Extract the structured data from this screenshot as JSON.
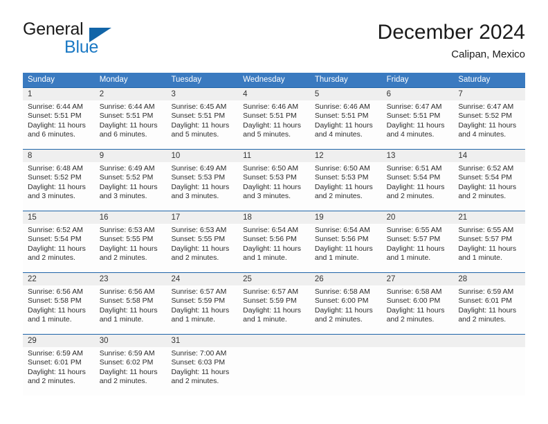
{
  "logo": {
    "word1": "General",
    "word2": "Blue",
    "triangle_color": "#1265a8",
    "blue_text_color": "#1b79c4"
  },
  "header": {
    "title": "December 2024",
    "subtitle": "Calipan, Mexico"
  },
  "theme": {
    "header_blue": "#3a7ac0",
    "separator_blue": "#1d63a8",
    "numrow_gray": "#efefef",
    "text_dark": "#2b2b2b"
  },
  "labels": {
    "sunrise_prefix": "Sunrise:",
    "sunset_prefix": "Sunset:",
    "daylight_prefix": "Daylight:"
  },
  "weekdays": [
    "Sunday",
    "Monday",
    "Tuesday",
    "Wednesday",
    "Thursday",
    "Friday",
    "Saturday"
  ],
  "weeks": [
    {
      "days": [
        {
          "num": "1",
          "sunrise": "Sunrise: 6:44 AM",
          "sunset": "Sunset: 5:51 PM",
          "daylight1": "Daylight: 11 hours",
          "daylight2": "and 6 minutes."
        },
        {
          "num": "2",
          "sunrise": "Sunrise: 6:44 AM",
          "sunset": "Sunset: 5:51 PM",
          "daylight1": "Daylight: 11 hours",
          "daylight2": "and 6 minutes."
        },
        {
          "num": "3",
          "sunrise": "Sunrise: 6:45 AM",
          "sunset": "Sunset: 5:51 PM",
          "daylight1": "Daylight: 11 hours",
          "daylight2": "and 5 minutes."
        },
        {
          "num": "4",
          "sunrise": "Sunrise: 6:46 AM",
          "sunset": "Sunset: 5:51 PM",
          "daylight1": "Daylight: 11 hours",
          "daylight2": "and 5 minutes."
        },
        {
          "num": "5",
          "sunrise": "Sunrise: 6:46 AM",
          "sunset": "Sunset: 5:51 PM",
          "daylight1": "Daylight: 11 hours",
          "daylight2": "and 4 minutes."
        },
        {
          "num": "6",
          "sunrise": "Sunrise: 6:47 AM",
          "sunset": "Sunset: 5:51 PM",
          "daylight1": "Daylight: 11 hours",
          "daylight2": "and 4 minutes."
        },
        {
          "num": "7",
          "sunrise": "Sunrise: 6:47 AM",
          "sunset": "Sunset: 5:52 PM",
          "daylight1": "Daylight: 11 hours",
          "daylight2": "and 4 minutes."
        }
      ]
    },
    {
      "days": [
        {
          "num": "8",
          "sunrise": "Sunrise: 6:48 AM",
          "sunset": "Sunset: 5:52 PM",
          "daylight1": "Daylight: 11 hours",
          "daylight2": "and 3 minutes."
        },
        {
          "num": "9",
          "sunrise": "Sunrise: 6:49 AM",
          "sunset": "Sunset: 5:52 PM",
          "daylight1": "Daylight: 11 hours",
          "daylight2": "and 3 minutes."
        },
        {
          "num": "10",
          "sunrise": "Sunrise: 6:49 AM",
          "sunset": "Sunset: 5:53 PM",
          "daylight1": "Daylight: 11 hours",
          "daylight2": "and 3 minutes."
        },
        {
          "num": "11",
          "sunrise": "Sunrise: 6:50 AM",
          "sunset": "Sunset: 5:53 PM",
          "daylight1": "Daylight: 11 hours",
          "daylight2": "and 3 minutes."
        },
        {
          "num": "12",
          "sunrise": "Sunrise: 6:50 AM",
          "sunset": "Sunset: 5:53 PM",
          "daylight1": "Daylight: 11 hours",
          "daylight2": "and 2 minutes."
        },
        {
          "num": "13",
          "sunrise": "Sunrise: 6:51 AM",
          "sunset": "Sunset: 5:54 PM",
          "daylight1": "Daylight: 11 hours",
          "daylight2": "and 2 minutes."
        },
        {
          "num": "14",
          "sunrise": "Sunrise: 6:52 AM",
          "sunset": "Sunset: 5:54 PM",
          "daylight1": "Daylight: 11 hours",
          "daylight2": "and 2 minutes."
        }
      ]
    },
    {
      "days": [
        {
          "num": "15",
          "sunrise": "Sunrise: 6:52 AM",
          "sunset": "Sunset: 5:54 PM",
          "daylight1": "Daylight: 11 hours",
          "daylight2": "and 2 minutes."
        },
        {
          "num": "16",
          "sunrise": "Sunrise: 6:53 AM",
          "sunset": "Sunset: 5:55 PM",
          "daylight1": "Daylight: 11 hours",
          "daylight2": "and 2 minutes."
        },
        {
          "num": "17",
          "sunrise": "Sunrise: 6:53 AM",
          "sunset": "Sunset: 5:55 PM",
          "daylight1": "Daylight: 11 hours",
          "daylight2": "and 2 minutes."
        },
        {
          "num": "18",
          "sunrise": "Sunrise: 6:54 AM",
          "sunset": "Sunset: 5:56 PM",
          "daylight1": "Daylight: 11 hours",
          "daylight2": "and 1 minute."
        },
        {
          "num": "19",
          "sunrise": "Sunrise: 6:54 AM",
          "sunset": "Sunset: 5:56 PM",
          "daylight1": "Daylight: 11 hours",
          "daylight2": "and 1 minute."
        },
        {
          "num": "20",
          "sunrise": "Sunrise: 6:55 AM",
          "sunset": "Sunset: 5:57 PM",
          "daylight1": "Daylight: 11 hours",
          "daylight2": "and 1 minute."
        },
        {
          "num": "21",
          "sunrise": "Sunrise: 6:55 AM",
          "sunset": "Sunset: 5:57 PM",
          "daylight1": "Daylight: 11 hours",
          "daylight2": "and 1 minute."
        }
      ]
    },
    {
      "days": [
        {
          "num": "22",
          "sunrise": "Sunrise: 6:56 AM",
          "sunset": "Sunset: 5:58 PM",
          "daylight1": "Daylight: 11 hours",
          "daylight2": "and 1 minute."
        },
        {
          "num": "23",
          "sunrise": "Sunrise: 6:56 AM",
          "sunset": "Sunset: 5:58 PM",
          "daylight1": "Daylight: 11 hours",
          "daylight2": "and 1 minute."
        },
        {
          "num": "24",
          "sunrise": "Sunrise: 6:57 AM",
          "sunset": "Sunset: 5:59 PM",
          "daylight1": "Daylight: 11 hours",
          "daylight2": "and 1 minute."
        },
        {
          "num": "25",
          "sunrise": "Sunrise: 6:57 AM",
          "sunset": "Sunset: 5:59 PM",
          "daylight1": "Daylight: 11 hours",
          "daylight2": "and 1 minute."
        },
        {
          "num": "26",
          "sunrise": "Sunrise: 6:58 AM",
          "sunset": "Sunset: 6:00 PM",
          "daylight1": "Daylight: 11 hours",
          "daylight2": "and 2 minutes."
        },
        {
          "num": "27",
          "sunrise": "Sunrise: 6:58 AM",
          "sunset": "Sunset: 6:00 PM",
          "daylight1": "Daylight: 11 hours",
          "daylight2": "and 2 minutes."
        },
        {
          "num": "28",
          "sunrise": "Sunrise: 6:59 AM",
          "sunset": "Sunset: 6:01 PM",
          "daylight1": "Daylight: 11 hours",
          "daylight2": "and 2 minutes."
        }
      ]
    },
    {
      "days": [
        {
          "num": "29",
          "sunrise": "Sunrise: 6:59 AM",
          "sunset": "Sunset: 6:01 PM",
          "daylight1": "Daylight: 11 hours",
          "daylight2": "and 2 minutes."
        },
        {
          "num": "30",
          "sunrise": "Sunrise: 6:59 AM",
          "sunset": "Sunset: 6:02 PM",
          "daylight1": "Daylight: 11 hours",
          "daylight2": "and 2 minutes."
        },
        {
          "num": "31",
          "sunrise": "Sunrise: 7:00 AM",
          "sunset": "Sunset: 6:03 PM",
          "daylight1": "Daylight: 11 hours",
          "daylight2": "and 2 minutes."
        },
        {
          "num": "",
          "sunrise": "",
          "sunset": "",
          "daylight1": "",
          "daylight2": ""
        },
        {
          "num": "",
          "sunrise": "",
          "sunset": "",
          "daylight1": "",
          "daylight2": ""
        },
        {
          "num": "",
          "sunrise": "",
          "sunset": "",
          "daylight1": "",
          "daylight2": ""
        },
        {
          "num": "",
          "sunrise": "",
          "sunset": "",
          "daylight1": "",
          "daylight2": ""
        }
      ]
    }
  ]
}
